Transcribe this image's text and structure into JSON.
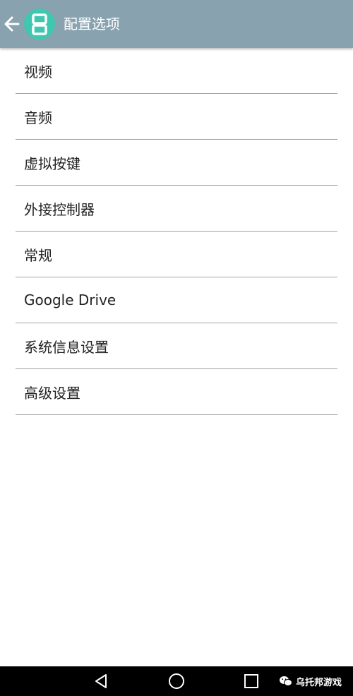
{
  "app_bar": {
    "title": "配置选项",
    "back_icon": "arrow-left-icon",
    "app_icon": "ds-console-icon",
    "background": "#88a2b0",
    "icon_color": "#3fc7b0"
  },
  "settings": {
    "items": [
      {
        "label": "视频"
      },
      {
        "label": "音频"
      },
      {
        "label": "虚拟按键"
      },
      {
        "label": "外接控制器"
      },
      {
        "label": "常规"
      },
      {
        "label": "Google Drive"
      },
      {
        "label": "系统信息设置"
      },
      {
        "label": "高级设置"
      }
    ]
  },
  "nav_bar": {
    "back_icon": "triangle-back-icon",
    "home_icon": "circle-home-icon",
    "recent_icon": "square-recent-icon",
    "watermark_icon": "wechat-icon",
    "watermark_text": "乌托邦游戏"
  }
}
